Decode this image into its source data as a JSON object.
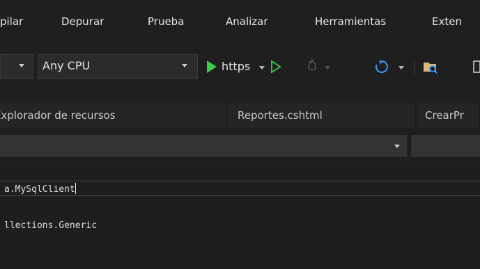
{
  "menu": {
    "items": [
      "pilar",
      "Depurar",
      "Prueba",
      "Analizar",
      "Herramientas",
      "Exten"
    ]
  },
  "toolbar": {
    "platform_value": "Any CPU",
    "run_profile_label": "https",
    "colors": {
      "run_green": "#3fc94c",
      "accent_blue": "#3a9bff"
    }
  },
  "tabs": [
    {
      "label": "Explorador de recursos"
    },
    {
      "label": "Reportes.cshtml"
    },
    {
      "label": "CrearPr"
    }
  ],
  "editor": {
    "lines": [
      "a.MySqlClient",
      "llections.Generic"
    ]
  }
}
